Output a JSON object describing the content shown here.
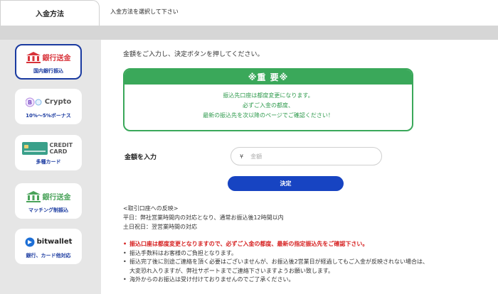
{
  "header": {
    "tab_label": "入金方法",
    "note": "入金方法を選択して下さい"
  },
  "sidebar": {
    "items": [
      {
        "title": "銀行送金",
        "subtitle": "国内銀行振込",
        "icon": "bank-icon"
      },
      {
        "title": "Crypto",
        "subtitle": "10%〜5%ボーナス",
        "icon": "crypto-coin-icon",
        "logo_text": "B y"
      },
      {
        "title": "CREDIT CARD",
        "subtitle": "多種カード",
        "icon": "credit-card-icon",
        "card_text": "CREDIT CARD"
      },
      {
        "title": "銀行送金",
        "subtitle": "マッチング制振込",
        "icon": "bank-icon"
      },
      {
        "title": "bitwallet",
        "subtitle": "銀行、カード他対応",
        "icon": "bitwallet-icon"
      }
    ]
  },
  "main": {
    "instruction": "金額をご入力し、決定ボタンを押してください。",
    "notice": {
      "title": "※重 要※",
      "lines": [
        "振込先口座は都度変更になります。",
        "必ずご入金の都度、",
        "最新の振込先を次以降のページでご確認ください！"
      ]
    },
    "amount": {
      "label": "金額を入力",
      "currency_symbol": "¥",
      "placeholder": "金額",
      "value": ""
    },
    "submit_label": "決定",
    "reflect": {
      "title": "<取引口座への反映>",
      "lines": [
        "平日：弊社営業時間内の対応となり、通常お振込後12時間以内",
        "土日祝日：翌営業時間の対応"
      ]
    },
    "notes": [
      "振込口座は都度変更となりますので、必ずご入金の都度、最新の指定振込先をご確認下さい。",
      "振込手数料はお客様のご負担となります。",
      "振込完了後に別途ご連絡を頂く必要はございませんが、お振込後2営業日が経過してもご入金が反映されない場合は、",
      "大変恐れ入りますが、弊社サポートまでご連絡下さいますようお願い致します。",
      "海外からのお振込は受け付けておりませんのでご了承ください。"
    ],
    "notes_bullet": "•"
  },
  "colors": {
    "accent_blue": "#1744c2",
    "notice_green": "#3aa85a",
    "bank_red": "#d8333a",
    "bank_green": "#4aa35a",
    "warning_red": "#d62020",
    "sidebar_gray": "#e6e6e6"
  }
}
